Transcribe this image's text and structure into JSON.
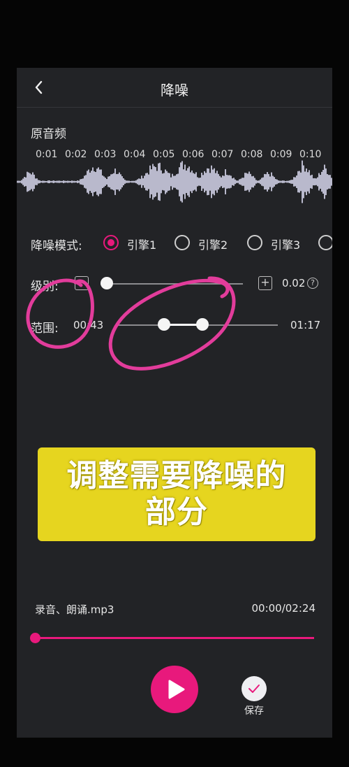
{
  "header": {
    "title": "降噪"
  },
  "original_audio": {
    "label": "原音频",
    "ticks": [
      "0:01",
      "0:02",
      "0:03",
      "0:04",
      "0:05",
      "0:06",
      "0:07",
      "0:08",
      "0:09",
      "0:10"
    ]
  },
  "mode": {
    "label": "降噪模式:",
    "options": [
      {
        "label": "引擎1",
        "selected": true
      },
      {
        "label": "引擎2",
        "selected": false
      },
      {
        "label": "引擎3",
        "selected": false
      },
      {
        "label": "",
        "selected": false
      }
    ]
  },
  "level": {
    "label": "级别:",
    "minus": "−",
    "plus": "+",
    "value": "0.02",
    "help": "?",
    "fraction": 0.0
  },
  "range": {
    "label": "范围:",
    "start": "00:43",
    "end": "01:17"
  },
  "banner": {
    "line1": "调整需要降噪的",
    "line2": "部分"
  },
  "player": {
    "file_name": "录音、朗诵.mp3",
    "time": "00:00/02:24",
    "progress": 0.0
  },
  "actions": {
    "save_label": "保存"
  },
  "colors": {
    "accent": "#e8197c",
    "background": "#222326",
    "banner": "#e6d51f",
    "waveform": "#b9b9cc"
  }
}
